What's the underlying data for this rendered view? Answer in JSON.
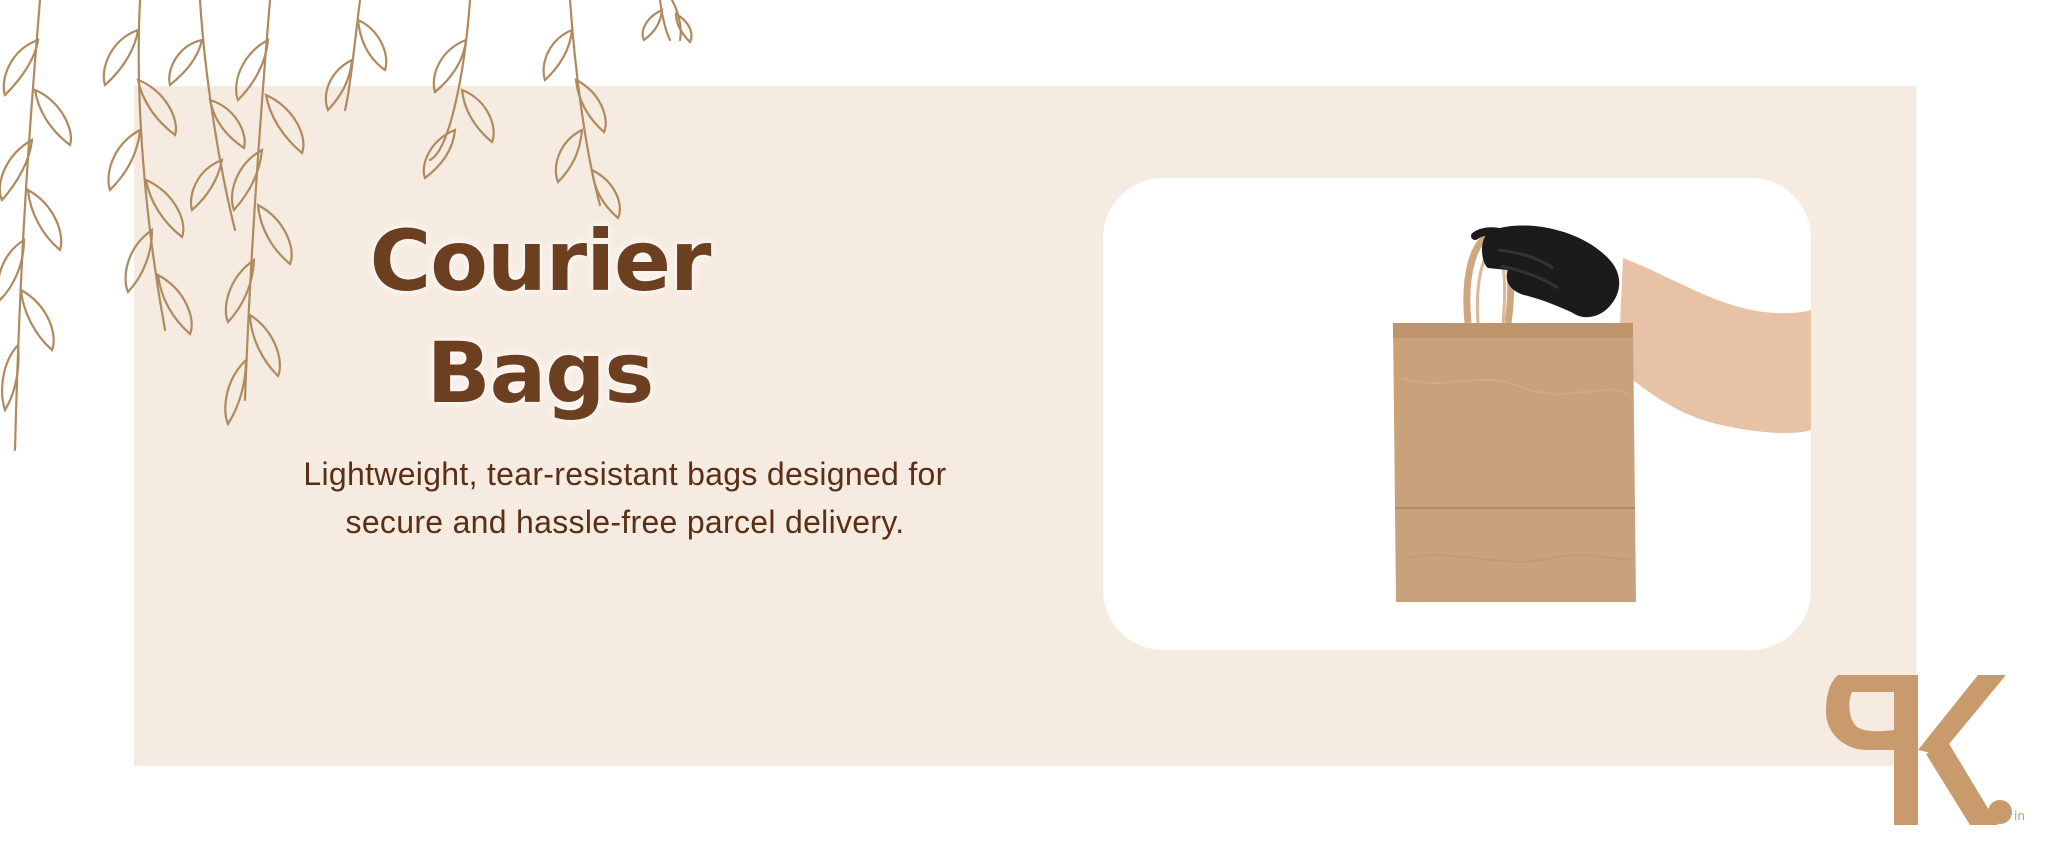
{
  "heading": {
    "line1": "Courier",
    "line2": "Bags"
  },
  "subtitle": {
    "line1": "Lightweight, tear-resistant bags designed for",
    "line2": "secure and hassle-free parcel delivery."
  },
  "image": {
    "alt": "Gloved hand holding a kraft paper bag"
  },
  "logo": {
    "letters": "PK",
    "suffix": "in"
  },
  "colors": {
    "banner_background": "#f6ebe0",
    "heading": "#6b3f1f",
    "body_text": "#5a2f16",
    "kraft": "#c9a27c",
    "logo": "#c99a6b",
    "foliage": "#b08a5f"
  }
}
